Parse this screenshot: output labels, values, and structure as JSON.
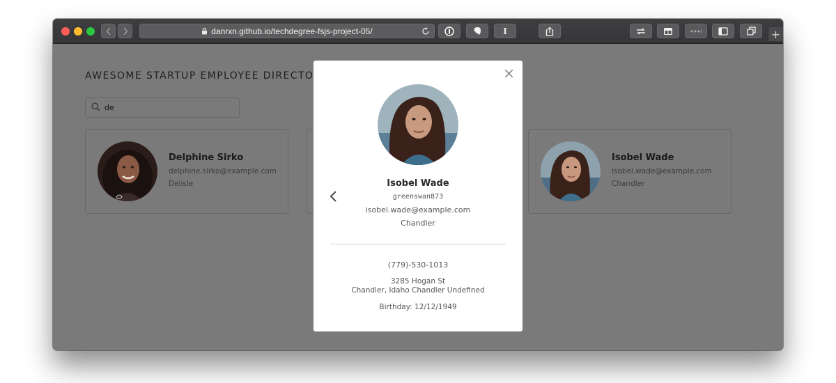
{
  "browser": {
    "url": "danrxn.github.io/techdegree-fsjs-project-05/",
    "new_tab_label": "+",
    "extension_text_label": "I"
  },
  "page": {
    "title": "AWESOME STARTUP EMPLOYEE DIRECTORY",
    "search": {
      "value": "de",
      "icon": "search-icon"
    },
    "cards": [
      {
        "name": "Delphine Sirko",
        "email": "delphine.sirko@example.com",
        "city": "Delisle"
      },
      {
        "name": "Isobel Wade",
        "email": "isobel.wade@example.com",
        "city": "Chandler"
      }
    ]
  },
  "modal": {
    "close_label": "×",
    "name": "Isobel Wade",
    "username": "greenswan873",
    "email": "isobel.wade@example.com",
    "city": "Chandler",
    "phone": "(779)-530-1013",
    "street": "3285 Hogan St",
    "region": "Chandler, Idaho Chandler Undefined",
    "birthday": "Birthday: 12/12/1949"
  },
  "colors": {
    "overlay_bg": "#7a7a7a",
    "modal_bg": "#ffffff",
    "toolbar_bg": "#3b3b3d",
    "traffic_red": "#fe5f57",
    "traffic_yellow": "#febc2e",
    "traffic_green": "#28c840"
  }
}
